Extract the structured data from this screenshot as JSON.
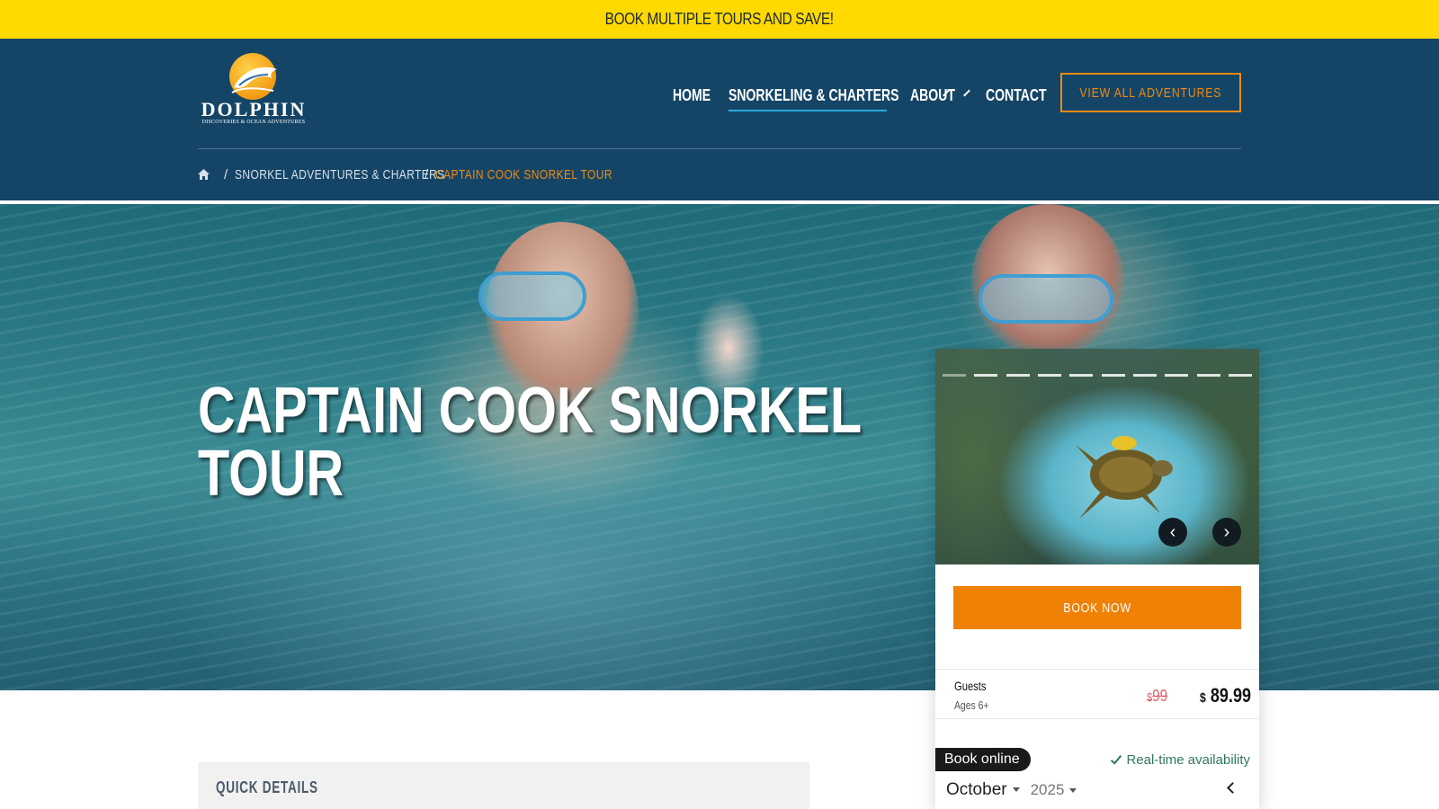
{
  "promo": {
    "text": "BOOK MULTIPLE TOURS AND SAVE!"
  },
  "brand": {
    "name": "DOLPHIN",
    "tagline": "DISCOVERIES & OCEAN ADVENTURES"
  },
  "nav": {
    "items": [
      {
        "label": "HOME"
      },
      {
        "label": "SNORKELING & CHARTERS",
        "active": true
      },
      {
        "label": "ABOUT"
      },
      {
        "label": "CONTACT"
      }
    ],
    "cta_label": "VIEW ALL ADVENTURES"
  },
  "breadcrumb": {
    "items": [
      "SNORKEL ADVENTURES & CHARTERS",
      "CAPTAIN COOK SNORKEL TOUR"
    ]
  },
  "hero": {
    "title_line1": "CAPTAIN COOK SNORKEL",
    "title_line2": "TOUR"
  },
  "widget": {
    "book_now_label": "BOOK NOW",
    "guests_label": "Guests",
    "guests_ages": "Ages 6+",
    "old_price_currency": "$",
    "old_price": "99",
    "price_currency": "$",
    "price": "89.99",
    "online_label": "Book online",
    "availability_label": "Real-time availability",
    "calendar_month": "October",
    "calendar_year": "2025",
    "slide_prev": "‹",
    "slide_next": "›"
  },
  "quick_details": {
    "title": "QUICK DETAILS"
  },
  "colors": {
    "promo_bg": "#ffd900",
    "header_bg": "#154566",
    "accent_orange": "#ef8106",
    "nav_underline": "#2fa8e4",
    "availability_green": "#2f7a55"
  }
}
